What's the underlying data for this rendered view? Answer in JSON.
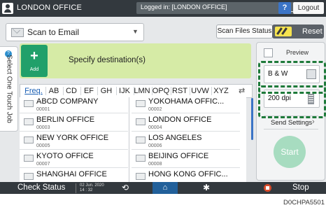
{
  "topbar": {
    "title": "LONDON OFFICE",
    "login_status": "Logged in: [LONDON OFFICE]",
    "help_label": "?",
    "logout_label": "Logout",
    "power_glyph": "("
  },
  "header": {
    "mode_label": "Scan to Email",
    "scan_status_label": "Scan Files Status",
    "reset_label": "Reset"
  },
  "side_tab": {
    "label": "Select One Touch Job",
    "badge": "?"
  },
  "destination": {
    "add_plus": "+",
    "add_label": "Add",
    "specify_label": "Specify destination(s)"
  },
  "tabs": [
    "Freq.",
    "AB",
    "CD",
    "EF",
    "GH",
    "IJK",
    "LMN",
    "OPQ",
    "RST",
    "UVW",
    "XYZ"
  ],
  "list": [
    {
      "name": "ABCD COMPANY",
      "num": "00001"
    },
    {
      "name": "YOKOHAMA OFFIC...",
      "num": "00002"
    },
    {
      "name": "BERLIN OFFICE",
      "num": "00003"
    },
    {
      "name": "LONDON OFFICE",
      "num": "00004"
    },
    {
      "name": "NEW YORK OFFICE",
      "num": "00005"
    },
    {
      "name": "LOS ANGELES",
      "num": "00006"
    },
    {
      "name": "KYOTO OFFICE",
      "num": "00007"
    },
    {
      "name": "BEIJING OFFICE",
      "num": "00008"
    },
    {
      "name": "SHANGHAI OFFICE",
      "num": ""
    },
    {
      "name": "HONG KONG OFFIC...",
      "num": ""
    }
  ],
  "settings": {
    "preview_label": "Preview",
    "color_label": "B & W",
    "resolution_label": "200 dpi",
    "send_settings_label": "Send Settings",
    "start_label": "Start"
  },
  "bottombar": {
    "check_status_label": "Check Status",
    "date": "02 Jun. 2020",
    "time": "14 : 32",
    "stop_label": "Stop"
  },
  "figure_id": "D0CHPA5501",
  "colors": {
    "highlight": "#1e7a3a",
    "add_button": "#21a06a",
    "destination_panel": "#d6eba6"
  },
  "icons": [
    "user-icon",
    "envelope-icon",
    "reset-icon",
    "swap-icon",
    "color-mode-icon",
    "resolution-icon",
    "back-icon",
    "home-icon",
    "gear-icon",
    "stop-icon"
  ]
}
